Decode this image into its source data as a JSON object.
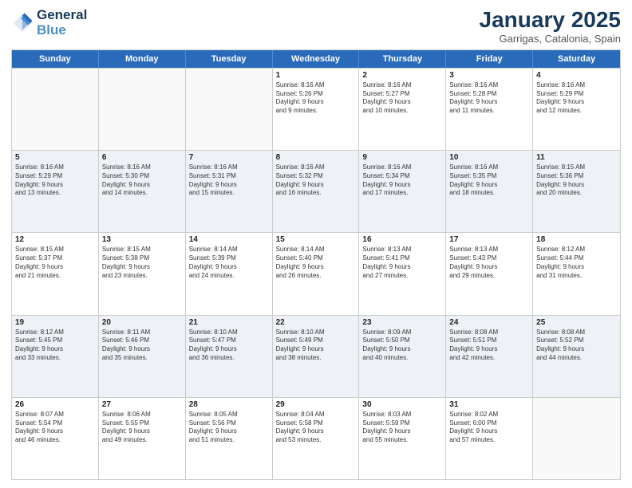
{
  "header": {
    "logo_line1": "General",
    "logo_line2": "Blue",
    "month": "January 2025",
    "location": "Garrigas, Catalonia, Spain"
  },
  "weekdays": [
    "Sunday",
    "Monday",
    "Tuesday",
    "Wednesday",
    "Thursday",
    "Friday",
    "Saturday"
  ],
  "rows": [
    [
      {
        "day": "",
        "lines": []
      },
      {
        "day": "",
        "lines": []
      },
      {
        "day": "",
        "lines": []
      },
      {
        "day": "1",
        "lines": [
          "Sunrise: 8:16 AM",
          "Sunset: 5:26 PM",
          "Daylight: 9 hours",
          "and 9 minutes."
        ]
      },
      {
        "day": "2",
        "lines": [
          "Sunrise: 8:16 AM",
          "Sunset: 5:27 PM",
          "Daylight: 9 hours",
          "and 10 minutes."
        ]
      },
      {
        "day": "3",
        "lines": [
          "Sunrise: 8:16 AM",
          "Sunset: 5:28 PM",
          "Daylight: 9 hours",
          "and 11 minutes."
        ]
      },
      {
        "day": "4",
        "lines": [
          "Sunrise: 8:16 AM",
          "Sunset: 5:29 PM",
          "Daylight: 9 hours",
          "and 12 minutes."
        ]
      }
    ],
    [
      {
        "day": "5",
        "lines": [
          "Sunrise: 8:16 AM",
          "Sunset: 5:29 PM",
          "Daylight: 9 hours",
          "and 13 minutes."
        ]
      },
      {
        "day": "6",
        "lines": [
          "Sunrise: 8:16 AM",
          "Sunset: 5:30 PM",
          "Daylight: 9 hours",
          "and 14 minutes."
        ]
      },
      {
        "day": "7",
        "lines": [
          "Sunrise: 8:16 AM",
          "Sunset: 5:31 PM",
          "Daylight: 9 hours",
          "and 15 minutes."
        ]
      },
      {
        "day": "8",
        "lines": [
          "Sunrise: 8:16 AM",
          "Sunset: 5:32 PM",
          "Daylight: 9 hours",
          "and 16 minutes."
        ]
      },
      {
        "day": "9",
        "lines": [
          "Sunrise: 8:16 AM",
          "Sunset: 5:34 PM",
          "Daylight: 9 hours",
          "and 17 minutes."
        ]
      },
      {
        "day": "10",
        "lines": [
          "Sunrise: 8:16 AM",
          "Sunset: 5:35 PM",
          "Daylight: 9 hours",
          "and 18 minutes."
        ]
      },
      {
        "day": "11",
        "lines": [
          "Sunrise: 8:15 AM",
          "Sunset: 5:36 PM",
          "Daylight: 9 hours",
          "and 20 minutes."
        ]
      }
    ],
    [
      {
        "day": "12",
        "lines": [
          "Sunrise: 8:15 AM",
          "Sunset: 5:37 PM",
          "Daylight: 9 hours",
          "and 21 minutes."
        ]
      },
      {
        "day": "13",
        "lines": [
          "Sunrise: 8:15 AM",
          "Sunset: 5:38 PM",
          "Daylight: 9 hours",
          "and 23 minutes."
        ]
      },
      {
        "day": "14",
        "lines": [
          "Sunrise: 8:14 AM",
          "Sunset: 5:39 PM",
          "Daylight: 9 hours",
          "and 24 minutes."
        ]
      },
      {
        "day": "15",
        "lines": [
          "Sunrise: 8:14 AM",
          "Sunset: 5:40 PM",
          "Daylight: 9 hours",
          "and 26 minutes."
        ]
      },
      {
        "day": "16",
        "lines": [
          "Sunrise: 8:13 AM",
          "Sunset: 5:41 PM",
          "Daylight: 9 hours",
          "and 27 minutes."
        ]
      },
      {
        "day": "17",
        "lines": [
          "Sunrise: 8:13 AM",
          "Sunset: 5:43 PM",
          "Daylight: 9 hours",
          "and 29 minutes."
        ]
      },
      {
        "day": "18",
        "lines": [
          "Sunrise: 8:12 AM",
          "Sunset: 5:44 PM",
          "Daylight: 9 hours",
          "and 31 minutes."
        ]
      }
    ],
    [
      {
        "day": "19",
        "lines": [
          "Sunrise: 8:12 AM",
          "Sunset: 5:45 PM",
          "Daylight: 9 hours",
          "and 33 minutes."
        ]
      },
      {
        "day": "20",
        "lines": [
          "Sunrise: 8:11 AM",
          "Sunset: 5:46 PM",
          "Daylight: 9 hours",
          "and 35 minutes."
        ]
      },
      {
        "day": "21",
        "lines": [
          "Sunrise: 8:10 AM",
          "Sunset: 5:47 PM",
          "Daylight: 9 hours",
          "and 36 minutes."
        ]
      },
      {
        "day": "22",
        "lines": [
          "Sunrise: 8:10 AM",
          "Sunset: 5:49 PM",
          "Daylight: 9 hours",
          "and 38 minutes."
        ]
      },
      {
        "day": "23",
        "lines": [
          "Sunrise: 8:09 AM",
          "Sunset: 5:50 PM",
          "Daylight: 9 hours",
          "and 40 minutes."
        ]
      },
      {
        "day": "24",
        "lines": [
          "Sunrise: 8:08 AM",
          "Sunset: 5:51 PM",
          "Daylight: 9 hours",
          "and 42 minutes."
        ]
      },
      {
        "day": "25",
        "lines": [
          "Sunrise: 8:08 AM",
          "Sunset: 5:52 PM",
          "Daylight: 9 hours",
          "and 44 minutes."
        ]
      }
    ],
    [
      {
        "day": "26",
        "lines": [
          "Sunrise: 8:07 AM",
          "Sunset: 5:54 PM",
          "Daylight: 9 hours",
          "and 46 minutes."
        ]
      },
      {
        "day": "27",
        "lines": [
          "Sunrise: 8:06 AM",
          "Sunset: 5:55 PM",
          "Daylight: 9 hours",
          "and 49 minutes."
        ]
      },
      {
        "day": "28",
        "lines": [
          "Sunrise: 8:05 AM",
          "Sunset: 5:56 PM",
          "Daylight: 9 hours",
          "and 51 minutes."
        ]
      },
      {
        "day": "29",
        "lines": [
          "Sunrise: 8:04 AM",
          "Sunset: 5:58 PM",
          "Daylight: 9 hours",
          "and 53 minutes."
        ]
      },
      {
        "day": "30",
        "lines": [
          "Sunrise: 8:03 AM",
          "Sunset: 5:59 PM",
          "Daylight: 9 hours",
          "and 55 minutes."
        ]
      },
      {
        "day": "31",
        "lines": [
          "Sunrise: 8:02 AM",
          "Sunset: 6:00 PM",
          "Daylight: 9 hours",
          "and 57 minutes."
        ]
      },
      {
        "day": "",
        "lines": []
      }
    ]
  ]
}
